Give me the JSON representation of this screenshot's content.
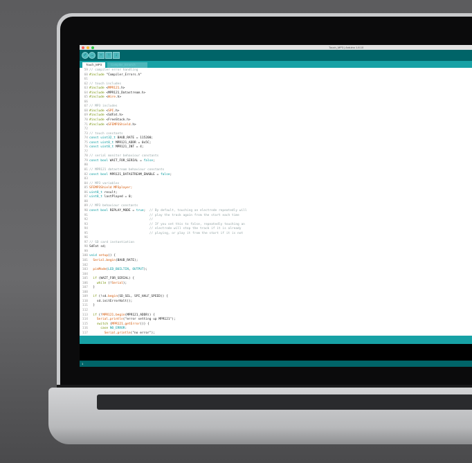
{
  "window": {
    "title": "Touch_MP3 | Arduino 1.8.10"
  },
  "toolbar": {
    "buttons": [
      {
        "name": "verify",
        "icon": "check-icon",
        "glyph": "✓"
      },
      {
        "name": "upload",
        "icon": "arrow-right-icon",
        "glyph": "→"
      },
      {
        "name": "new",
        "icon": "new-file-icon",
        "glyph": "▫"
      },
      {
        "name": "open",
        "icon": "open-icon",
        "glyph": "↑"
      },
      {
        "name": "save",
        "icon": "save-icon",
        "glyph": "↓"
      }
    ]
  },
  "tabs": [
    {
      "label": "Touch_MP3",
      "active": true
    },
    {
      "label": "Compiler_Errors.h",
      "active": false
    }
  ],
  "colors": {
    "c": "#95a5a6",
    "k": "#728e00",
    "t": "#00979c",
    "l": "#d35400",
    "p": "#222222",
    "accent": "#00979c",
    "toolbar": "#006468"
  },
  "status": {
    "line": "1"
  },
  "code": [
    {
      "n": "59",
      "s": [
        [
          "// compiler error handling",
          "c"
        ]
      ]
    },
    {
      "n": "60",
      "s": [
        [
          "#include",
          "k"
        ],
        [
          " \"Compiler_Errors.h\"",
          "p"
        ]
      ]
    },
    {
      "n": "61",
      "s": []
    },
    {
      "n": "62",
      "s": [
        [
          "// touch includes",
          "c"
        ]
      ]
    },
    {
      "n": "63",
      "s": [
        [
          "#include",
          "k"
        ],
        [
          " <",
          "p"
        ],
        [
          "MPR121",
          "l"
        ],
        [
          ".h>",
          "p"
        ]
      ]
    },
    {
      "n": "64",
      "s": [
        [
          "#include",
          "k"
        ],
        [
          " <MPR121_Datastream.h>",
          "p"
        ]
      ]
    },
    {
      "n": "65",
      "s": [
        [
          "#include",
          "k"
        ],
        [
          " <",
          "p"
        ],
        [
          "Wire",
          "l"
        ],
        [
          ".h>",
          "p"
        ]
      ]
    },
    {
      "n": "66",
      "s": []
    },
    {
      "n": "67",
      "s": [
        [
          "// MP3 includes",
          "c"
        ]
      ]
    },
    {
      "n": "68",
      "s": [
        [
          "#include",
          "k"
        ],
        [
          " <",
          "p"
        ],
        [
          "SPI",
          "l"
        ],
        [
          ".h>",
          "p"
        ]
      ]
    },
    {
      "n": "69",
      "s": [
        [
          "#include",
          "k"
        ],
        [
          " <SdFat.h>",
          "p"
        ]
      ]
    },
    {
      "n": "70",
      "s": [
        [
          "#include",
          "k"
        ],
        [
          " <FreeStack.h>",
          "p"
        ]
      ]
    },
    {
      "n": "71",
      "s": [
        [
          "#include",
          "k"
        ],
        [
          " <",
          "p"
        ],
        [
          "SFEMP3Shield",
          "l"
        ],
        [
          ".h>",
          "p"
        ]
      ]
    },
    {
      "n": "72",
      "s": []
    },
    {
      "n": "73",
      "s": [
        [
          "// touch constants",
          "c"
        ]
      ]
    },
    {
      "n": "74",
      "s": [
        [
          "const uint32_t",
          "t"
        ],
        [
          " BAUD_RATE = 115200;",
          "p"
        ]
      ]
    },
    {
      "n": "75",
      "s": [
        [
          "const uint8_t",
          "t"
        ],
        [
          " MPR121_ADDR = 0x5C;",
          "p"
        ]
      ]
    },
    {
      "n": "76",
      "s": [
        [
          "const uint8_t",
          "t"
        ],
        [
          " MPR121_INT = 4;",
          "p"
        ]
      ]
    },
    {
      "n": "77",
      "s": []
    },
    {
      "n": "78",
      "s": [
        [
          "// serial monitor behaviour constants",
          "c"
        ]
      ]
    },
    {
      "n": "79",
      "s": [
        [
          "const bool",
          "t"
        ],
        [
          " WAIT_FOR_SERIAL = ",
          "p"
        ],
        [
          "false",
          "t"
        ],
        [
          ";",
          "p"
        ]
      ]
    },
    {
      "n": "80",
      "s": []
    },
    {
      "n": "81",
      "s": [
        [
          "// MPR121 datastream behaviour constants",
          "c"
        ]
      ]
    },
    {
      "n": "82",
      "s": [
        [
          "const bool",
          "t"
        ],
        [
          " MPR121_DATASTREAM_ENABLE = ",
          "p"
        ],
        [
          "false",
          "t"
        ],
        [
          ";",
          "p"
        ]
      ]
    },
    {
      "n": "83",
      "s": []
    },
    {
      "n": "84",
      "s": [
        [
          "// MP3 variables",
          "c"
        ]
      ]
    },
    {
      "n": "85",
      "s": [
        [
          "SFEMP3Shield MP3player;",
          "l"
        ]
      ]
    },
    {
      "n": "86",
      "s": [
        [
          "uint8_t",
          "t"
        ],
        [
          " result;",
          "p"
        ]
      ]
    },
    {
      "n": "87",
      "s": [
        [
          "uint8_t",
          "t"
        ],
        [
          " lastPlayed = 0;",
          "p"
        ]
      ]
    },
    {
      "n": "88",
      "s": []
    },
    {
      "n": "89",
      "s": [
        [
          "// MP3 behaviour constants",
          "c"
        ]
      ]
    },
    {
      "n": "90",
      "s": [
        [
          "const bool",
          "t"
        ],
        [
          " REPLAY_MODE = ",
          "p"
        ],
        [
          "true",
          "t"
        ],
        [
          ";  ",
          "p"
        ],
        [
          "// By default, touching an electrode repeatedly will",
          "c"
        ]
      ]
    },
    {
      "n": "91",
      "s": [
        [
          "                                // play the track again from the start each time",
          "c"
        ]
      ]
    },
    {
      "n": "92",
      "s": [
        [
          "                                //",
          "c"
        ]
      ]
    },
    {
      "n": "93",
      "s": [
        [
          "                                // If you set this to false, repeatedly touching an",
          "c"
        ]
      ]
    },
    {
      "n": "94",
      "s": [
        [
          "                                // electrode will stop the track if it is already",
          "c"
        ]
      ]
    },
    {
      "n": "95",
      "s": [
        [
          "                                // playing, or play it from the start if it is not",
          "c"
        ]
      ]
    },
    {
      "n": "96",
      "s": []
    },
    {
      "n": "97",
      "s": [
        [
          "// SD card instantiation",
          "c"
        ]
      ]
    },
    {
      "n": "98",
      "s": [
        [
          "SdFat sd;",
          "p"
        ]
      ]
    },
    {
      "n": "99",
      "s": []
    },
    {
      "n": "100",
      "s": [
        [
          "void",
          "t"
        ],
        [
          " ",
          "p"
        ],
        [
          "setup",
          "l"
        ],
        [
          "() {",
          "p"
        ]
      ]
    },
    {
      "n": "101",
      "s": [
        [
          "  ",
          "p"
        ],
        [
          "Serial",
          "l"
        ],
        [
          ".",
          "p"
        ],
        [
          "begin",
          "l"
        ],
        [
          "(BAUD_RATE);",
          "p"
        ]
      ]
    },
    {
      "n": "102",
      "s": []
    },
    {
      "n": "103",
      "s": [
        [
          "  ",
          "p"
        ],
        [
          "pinMode",
          "l"
        ],
        [
          "(",
          "p"
        ],
        [
          "LED_BUILTIN",
          "t"
        ],
        [
          ", ",
          "p"
        ],
        [
          "OUTPUT",
          "t"
        ],
        [
          ");",
          "p"
        ]
      ]
    },
    {
      "n": "104",
      "s": []
    },
    {
      "n": "105",
      "s": [
        [
          "  ",
          "p"
        ],
        [
          "if",
          "k"
        ],
        [
          " (WAIT_FOR_SERIAL) {",
          "p"
        ]
      ]
    },
    {
      "n": "106",
      "s": [
        [
          "    ",
          "p"
        ],
        [
          "while",
          "k"
        ],
        [
          " (!",
          "p"
        ],
        [
          "Serial",
          "l"
        ],
        [
          ");",
          "p"
        ]
      ]
    },
    {
      "n": "107",
      "s": [
        [
          "  }",
          "p"
        ]
      ]
    },
    {
      "n": "108",
      "s": []
    },
    {
      "n": "109",
      "s": [
        [
          "  ",
          "p"
        ],
        [
          "if",
          "k"
        ],
        [
          " (!sd.",
          "p"
        ],
        [
          "begin",
          "l"
        ],
        [
          "(SD_SEL, SPI_HALF_SPEED)) {",
          "p"
        ]
      ]
    },
    {
      "n": "110",
      "s": [
        [
          "    sd.initErrorHalt();",
          "p"
        ]
      ]
    },
    {
      "n": "111",
      "s": [
        [
          "  }",
          "p"
        ]
      ]
    },
    {
      "n": "112",
      "s": []
    },
    {
      "n": "113",
      "s": [
        [
          "  ",
          "p"
        ],
        [
          "if",
          "k"
        ],
        [
          " (!",
          "p"
        ],
        [
          "MPR121",
          "l"
        ],
        [
          ".",
          "p"
        ],
        [
          "begin",
          "l"
        ],
        [
          "(MPR121_ADDR)) {",
          "p"
        ]
      ]
    },
    {
      "n": "114",
      "s": [
        [
          "    ",
          "p"
        ],
        [
          "Serial",
          "l"
        ],
        [
          ".",
          "p"
        ],
        [
          "println",
          "l"
        ],
        [
          "(\"error setting up MPR121\");",
          "p"
        ]
      ]
    },
    {
      "n": "115",
      "s": [
        [
          "    ",
          "p"
        ],
        [
          "switch",
          "k"
        ],
        [
          " (",
          "p"
        ],
        [
          "MPR121",
          "l"
        ],
        [
          ".",
          "p"
        ],
        [
          "getError",
          "l"
        ],
        [
          "()) {",
          "p"
        ]
      ]
    },
    {
      "n": "116",
      "s": [
        [
          "      ",
          "p"
        ],
        [
          "case",
          "k"
        ],
        [
          " ",
          "p"
        ],
        [
          "NO_ERROR",
          "t"
        ],
        [
          ":",
          "p"
        ]
      ]
    },
    {
      "n": "117",
      "s": [
        [
          "        ",
          "p"
        ],
        [
          "Serial",
          "l"
        ],
        [
          ".",
          "p"
        ],
        [
          "println",
          "l"
        ],
        [
          "(\"no error\");",
          "p"
        ]
      ]
    }
  ]
}
